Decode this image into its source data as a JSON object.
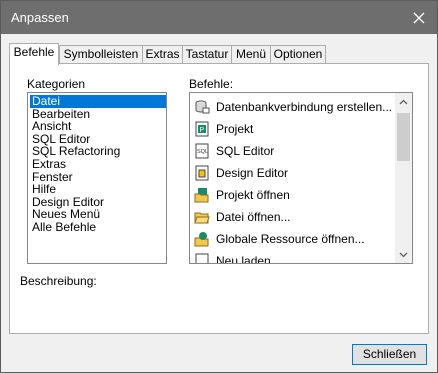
{
  "window": {
    "title": "Anpassen",
    "close_label": "Close"
  },
  "tabs": [
    {
      "label": "Befehle",
      "active": true
    },
    {
      "label": "Symbolleisten"
    },
    {
      "label": "Extras"
    },
    {
      "label": "Tastatur"
    },
    {
      "label": "Menü"
    },
    {
      "label": "Optionen"
    }
  ],
  "kategorien": {
    "label": "Kategorien",
    "items": [
      "Datei",
      "Bearbeiten",
      "Ansicht",
      "SQL Editor",
      "SQL Refactoring",
      "Extras",
      "Fenster",
      "Hilfe",
      "Design Editor",
      "Neues Menü",
      "Alle Befehle"
    ],
    "selected": "Datei"
  },
  "befehle": {
    "label": "Befehle:",
    "items": [
      {
        "label": "Datenbankverbindung erstellen...",
        "icon": "database-connection-icon"
      },
      {
        "label": "Projekt",
        "icon": "project-icon"
      },
      {
        "label": "SQL Editor",
        "icon": "sql-editor-icon"
      },
      {
        "label": "Design Editor",
        "icon": "design-editor-icon"
      },
      {
        "label": "Projekt öffnen",
        "icon": "open-project-icon"
      },
      {
        "label": "Datei öffnen...",
        "icon": "open-folder-icon"
      },
      {
        "label": "Globale Ressource öffnen...",
        "icon": "global-resource-icon"
      },
      {
        "label": "Neu laden",
        "icon": "reload-icon"
      }
    ]
  },
  "beschreibung": {
    "label": "Beschreibung:"
  },
  "footer": {
    "close_button": "Schließen"
  },
  "colors": {
    "titlebar": "#6e6e6e",
    "selection": "#0078d7",
    "dialog_bg": "#f0f0f0"
  }
}
